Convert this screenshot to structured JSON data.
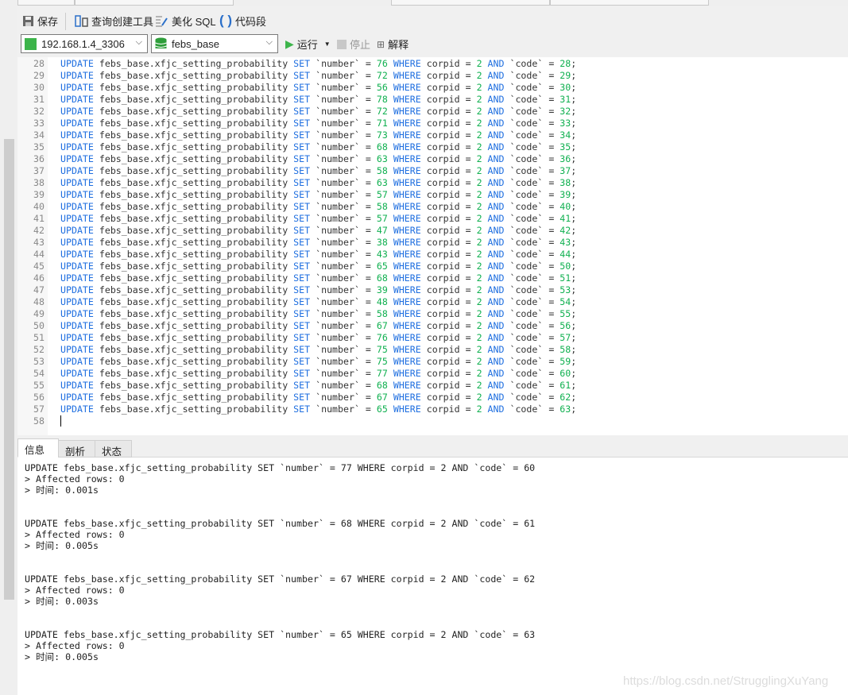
{
  "toolbar": {
    "save": "保存",
    "query_builder": "查询创建工具",
    "beautify_sql": "美化 SQL",
    "snippet": "代码段",
    "connection": "192.168.1.4_3306",
    "database": "febs_base",
    "run": "运行",
    "stop": "停止",
    "explain": "解释"
  },
  "editor": {
    "table": "febs_base.xfjc_setting_probability",
    "corpid": 2,
    "statements": [
      {
        "line": 28,
        "number": 76,
        "code": 28
      },
      {
        "line": 29,
        "number": 72,
        "code": 29
      },
      {
        "line": 30,
        "number": 56,
        "code": 30
      },
      {
        "line": 31,
        "number": 78,
        "code": 31
      },
      {
        "line": 32,
        "number": 72,
        "code": 32
      },
      {
        "line": 33,
        "number": 71,
        "code": 33
      },
      {
        "line": 34,
        "number": 73,
        "code": 34
      },
      {
        "line": 35,
        "number": 68,
        "code": 35
      },
      {
        "line": 36,
        "number": 63,
        "code": 36
      },
      {
        "line": 37,
        "number": 58,
        "code": 37
      },
      {
        "line": 38,
        "number": 63,
        "code": 38
      },
      {
        "line": 39,
        "number": 57,
        "code": 39
      },
      {
        "line": 40,
        "number": 58,
        "code": 40
      },
      {
        "line": 41,
        "number": 57,
        "code": 41
      },
      {
        "line": 42,
        "number": 47,
        "code": 42
      },
      {
        "line": 43,
        "number": 38,
        "code": 43
      },
      {
        "line": 44,
        "number": 43,
        "code": 44
      },
      {
        "line": 45,
        "number": 65,
        "code": 50
      },
      {
        "line": 46,
        "number": 68,
        "code": 51
      },
      {
        "line": 47,
        "number": 39,
        "code": 53
      },
      {
        "line": 48,
        "number": 48,
        "code": 54
      },
      {
        "line": 49,
        "number": 58,
        "code": 55
      },
      {
        "line": 50,
        "number": 67,
        "code": 56
      },
      {
        "line": 51,
        "number": 76,
        "code": 57
      },
      {
        "line": 52,
        "number": 75,
        "code": 58
      },
      {
        "line": 53,
        "number": 75,
        "code": 59
      },
      {
        "line": 54,
        "number": 77,
        "code": 60
      },
      {
        "line": 55,
        "number": 68,
        "code": 61
      },
      {
        "line": 56,
        "number": 67,
        "code": 62
      },
      {
        "line": 57,
        "number": 65,
        "code": 63
      }
    ],
    "last_line": 58
  },
  "result_tabs": [
    "信息",
    "剖析",
    "状态"
  ],
  "messages": [
    {
      "sql": "UPDATE febs_base.xfjc_setting_probability SET `number` = 77 WHERE corpid = 2 AND `code` = 60",
      "affected": "> Affected rows: 0",
      "time": "> 时间: 0.001s"
    },
    {
      "sql": "UPDATE febs_base.xfjc_setting_probability SET `number` = 68 WHERE corpid = 2 AND `code` = 61",
      "affected": "> Affected rows: 0",
      "time": "> 时间: 0.005s"
    },
    {
      "sql": "UPDATE febs_base.xfjc_setting_probability SET `number` = 67 WHERE corpid = 2 AND `code` = 62",
      "affected": "> Affected rows: 0",
      "time": "> 时间: 0.003s"
    },
    {
      "sql": "UPDATE febs_base.xfjc_setting_probability SET `number` = 65 WHERE corpid = 2 AND `code` = 63",
      "affected": "> Affected rows: 0",
      "time": "> 时间: 0.005s"
    }
  ],
  "watermark": "https://blog.csdn.net/StrugglingXuYang",
  "colors": {
    "keyword": "#1f6fe0",
    "number": "#10b050"
  }
}
